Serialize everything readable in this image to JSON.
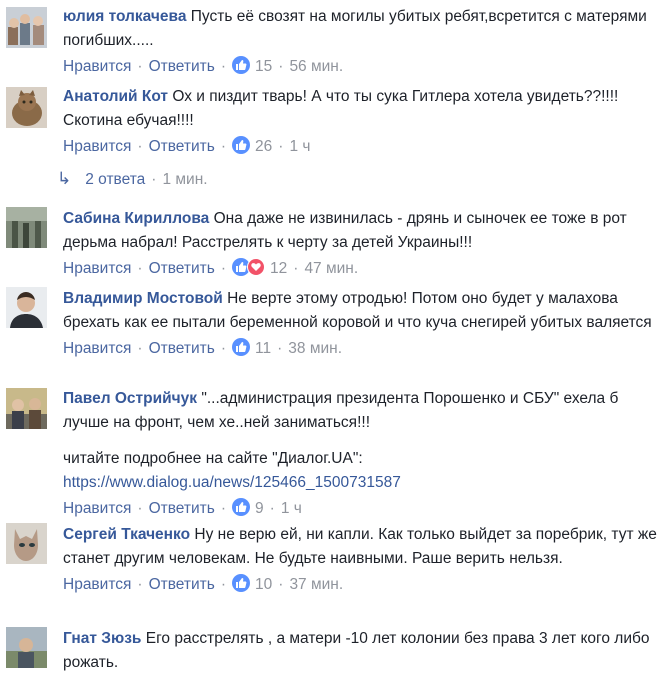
{
  "actions": {
    "like": "Нравится",
    "reply": "Ответить"
  },
  "comments": [
    {
      "author": "юлия толкачева",
      "text": "Пусть её свозят на могилы убитых ребят,всретится с матерями погибших.....",
      "likes": "15",
      "time": "56 мин.",
      "reactions": [
        "like-icon"
      ]
    },
    {
      "author": "Анатолий Кот",
      "text": "Ох и пиздит тварь! А что ты сука Гитлера хотела увидеть??!!!! Скотина ебучая!!!!",
      "likes": "26",
      "time": "1 ч",
      "reactions": [
        "like-icon"
      ]
    },
    {
      "author": "Сабина Кириллова",
      "text": "Она даже не извинилась - дрянь и сыночек ее тоже в рот дерьма набрал! Расстрелять к черту за детей Украины!!!",
      "likes": "12",
      "time": "47 мин.",
      "reactions": [
        "like-icon",
        "love-icon"
      ]
    },
    {
      "author": "Владимир Мостовой",
      "text": "Не верте этому отродью! Потом оно будет у малахова брехать как ее пытали беременной коровой и что куча снегирей убитых валяется",
      "likes": "11",
      "time": "38 мин.",
      "reactions": [
        "like-icon"
      ]
    },
    {
      "author": "Павел Острийчук",
      "text": "\"...администрация президента Порошенко и СБУ\" ехела б лучше на фронт, чем хе..ней заниматься!!!",
      "extra": "читайте подробнее на сайте \"Диалог.UA\":",
      "url": "https://www.dialog.ua/news/125466_1500731587",
      "likes": "9",
      "time": "1 ч",
      "reactions": [
        "like-icon"
      ]
    },
    {
      "author": "Сергей Ткаченко",
      "text": "Ну не верю ей, ни капли. Как только выйдет за поребрик, тут же станет другим человекам. Не будьте наивными. Раше верить нельзя.",
      "likes": "10",
      "time": "37 мин.",
      "reactions": [
        "like-icon"
      ]
    },
    {
      "author": "Гнат Зюзь",
      "text": "Его расстрелять , а матери -10 лет колонии без права 3 лет кого либо рожать."
    }
  ],
  "replies": {
    "label": "2 ответа",
    "time": "1 мин."
  },
  "colors": {
    "link": "#365899",
    "action": "#4b67a1",
    "meta": "#90949c",
    "like": "#5890ff",
    "love": "#f25268"
  }
}
